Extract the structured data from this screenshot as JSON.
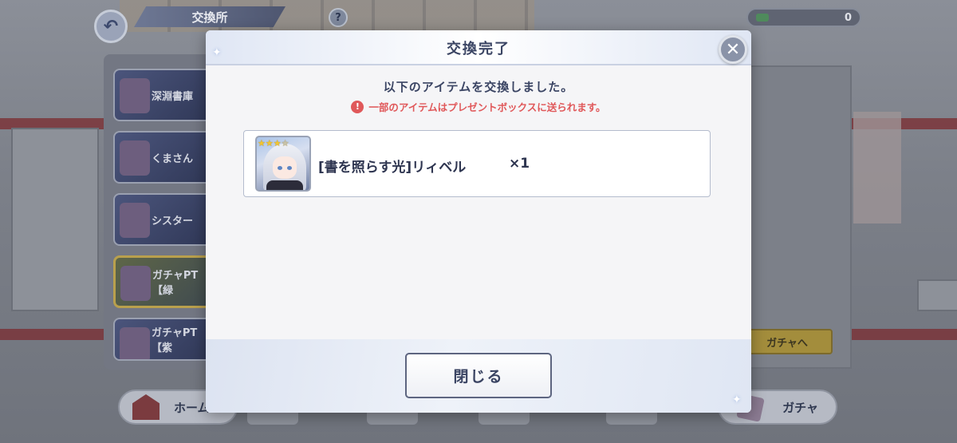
{
  "background": {
    "header": {
      "title": "交換所",
      "help_label": "?",
      "currency_value": "0"
    },
    "list_items": [
      "深淵書庫",
      "くまさん",
      "シスター",
      "ガチャPT【緑",
      "ガチャPT【紫"
    ],
    "gacha_go_label": "ガチャへ",
    "nav": {
      "home_label": "ホーム",
      "gacha_label": "ガチャ"
    }
  },
  "modal": {
    "title": "交換完了",
    "message": "以下のアイテムを交換しました。",
    "warning": "一部のアイテムはプレゼントボックスに送られます。",
    "reward": {
      "name": "[書を照らす光]リィベル",
      "quantity": "×1",
      "rarity_stars": 3
    },
    "close_label": "閉じる"
  },
  "colors": {
    "title_text": "#3a4463",
    "warning": "#e0585a",
    "star": "#f2c531"
  }
}
